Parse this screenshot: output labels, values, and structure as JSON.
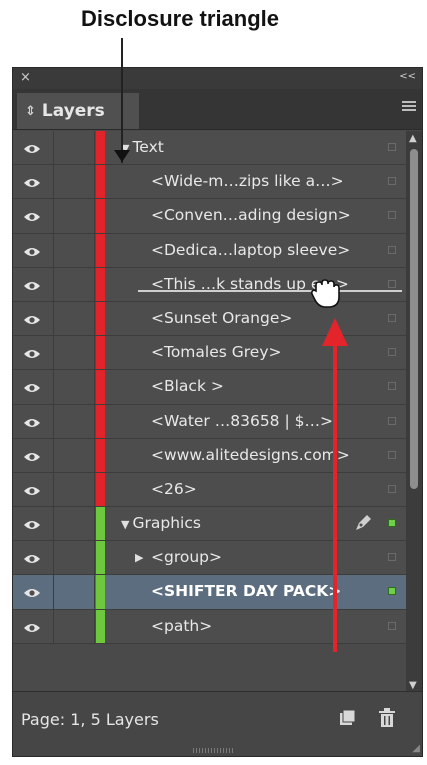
{
  "callout": {
    "label": "Disclosure triangle"
  },
  "panel": {
    "title_close": "×",
    "title_collapse": "<<",
    "tab_label": "Layers"
  },
  "rows": [
    {
      "label": "Text",
      "type": "layer",
      "color": "#e0242a",
      "expanded": true
    },
    {
      "label": "<Wide-m…zips like a…>",
      "type": "object",
      "color": "#e0242a"
    },
    {
      "label": "<Conven…ading design>",
      "type": "object",
      "color": "#e0242a"
    },
    {
      "label": "<Dedica…laptop sleeve>",
      "type": "object",
      "color": "#e0242a"
    },
    {
      "label": "<This …k stands up e…>",
      "type": "object",
      "color": "#e0242a"
    },
    {
      "label": "<Sunset Orange>",
      "type": "object",
      "color": "#e0242a"
    },
    {
      "label": "<Tomales Grey>",
      "type": "object",
      "color": "#e0242a"
    },
    {
      "label": "<Black >",
      "type": "object",
      "color": "#e0242a"
    },
    {
      "label": "<Water …83658 | $…>",
      "type": "object",
      "color": "#e0242a"
    },
    {
      "label": "<www.alitedesigns.com>",
      "type": "object",
      "color": "#e0242a"
    },
    {
      "label": "<26>",
      "type": "object",
      "color": "#e0242a"
    },
    {
      "label": "Graphics",
      "type": "layer",
      "color": "#6ec83e",
      "expanded": true,
      "target_layer": true
    },
    {
      "label": "<group>",
      "type": "group",
      "color": "#6ec83e"
    },
    {
      "label": "<SHIFTER DAY PACK>",
      "type": "object",
      "color": "#6ec83e",
      "selected": true
    },
    {
      "label": "<path>",
      "type": "object",
      "color": "#6ec83e"
    }
  ],
  "footer": {
    "status": "Page: 1, 5 Layers"
  },
  "colors": {
    "text_layer": "#e0242a",
    "graphics_layer": "#6ec83e",
    "drag_arrow": "#e3242b",
    "selection": "#5d6d80"
  },
  "icons": [
    "eye-icon",
    "pen-icon",
    "new-layer-icon",
    "trash-icon",
    "panel-menu-icon",
    "disclosure-triangle-icon"
  ]
}
